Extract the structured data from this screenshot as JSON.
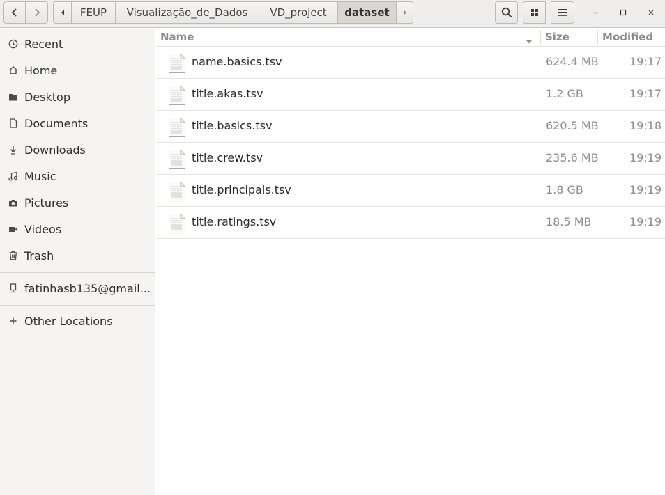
{
  "header": {
    "breadcrumbs": [
      "FEUP",
      "Visualização_de_Dados",
      "VD_project",
      "dataset"
    ],
    "icons": {
      "back": "chevron-left-icon",
      "forward": "chevron-right-icon",
      "crumb_left": "triangle-left-icon",
      "crumb_right": "triangle-right-icon",
      "search": "search-icon",
      "view": "grid-view-icon",
      "menu": "hamburger-menu-icon",
      "minimize": "minimize-icon",
      "maximize": "maximize-icon",
      "close": "close-icon"
    }
  },
  "sidebar": {
    "items": [
      {
        "label": "Recent",
        "icon": "clock-icon"
      },
      {
        "label": "Home",
        "icon": "home-icon"
      },
      {
        "label": "Desktop",
        "icon": "folder-icon"
      },
      {
        "label": "Documents",
        "icon": "document-icon"
      },
      {
        "label": "Downloads",
        "icon": "download-icon"
      },
      {
        "label": "Music",
        "icon": "music-icon"
      },
      {
        "label": "Pictures",
        "icon": "camera-icon"
      },
      {
        "label": "Videos",
        "icon": "video-icon"
      },
      {
        "label": "Trash",
        "icon": "trash-icon"
      }
    ],
    "account": {
      "label": "fatinhasb135@gmail...",
      "icon": "network-drive-icon"
    },
    "other": {
      "label": "Other Locations",
      "icon": "plus-icon"
    }
  },
  "columns": {
    "name": "Name",
    "size": "Size",
    "modified": "Modified"
  },
  "files": [
    {
      "name": "name.basics.tsv",
      "size": "624.4 MB",
      "modified": "19:17"
    },
    {
      "name": "title.akas.tsv",
      "size": "1.2 GB",
      "modified": "19:17"
    },
    {
      "name": "title.basics.tsv",
      "size": "620.5 MB",
      "modified": "19:18"
    },
    {
      "name": "title.crew.tsv",
      "size": "235.6 MB",
      "modified": "19:19"
    },
    {
      "name": "title.principals.tsv",
      "size": "1.8 GB",
      "modified": "19:19"
    },
    {
      "name": "title.ratings.tsv",
      "size": "18.5 MB",
      "modified": "19:19"
    }
  ]
}
